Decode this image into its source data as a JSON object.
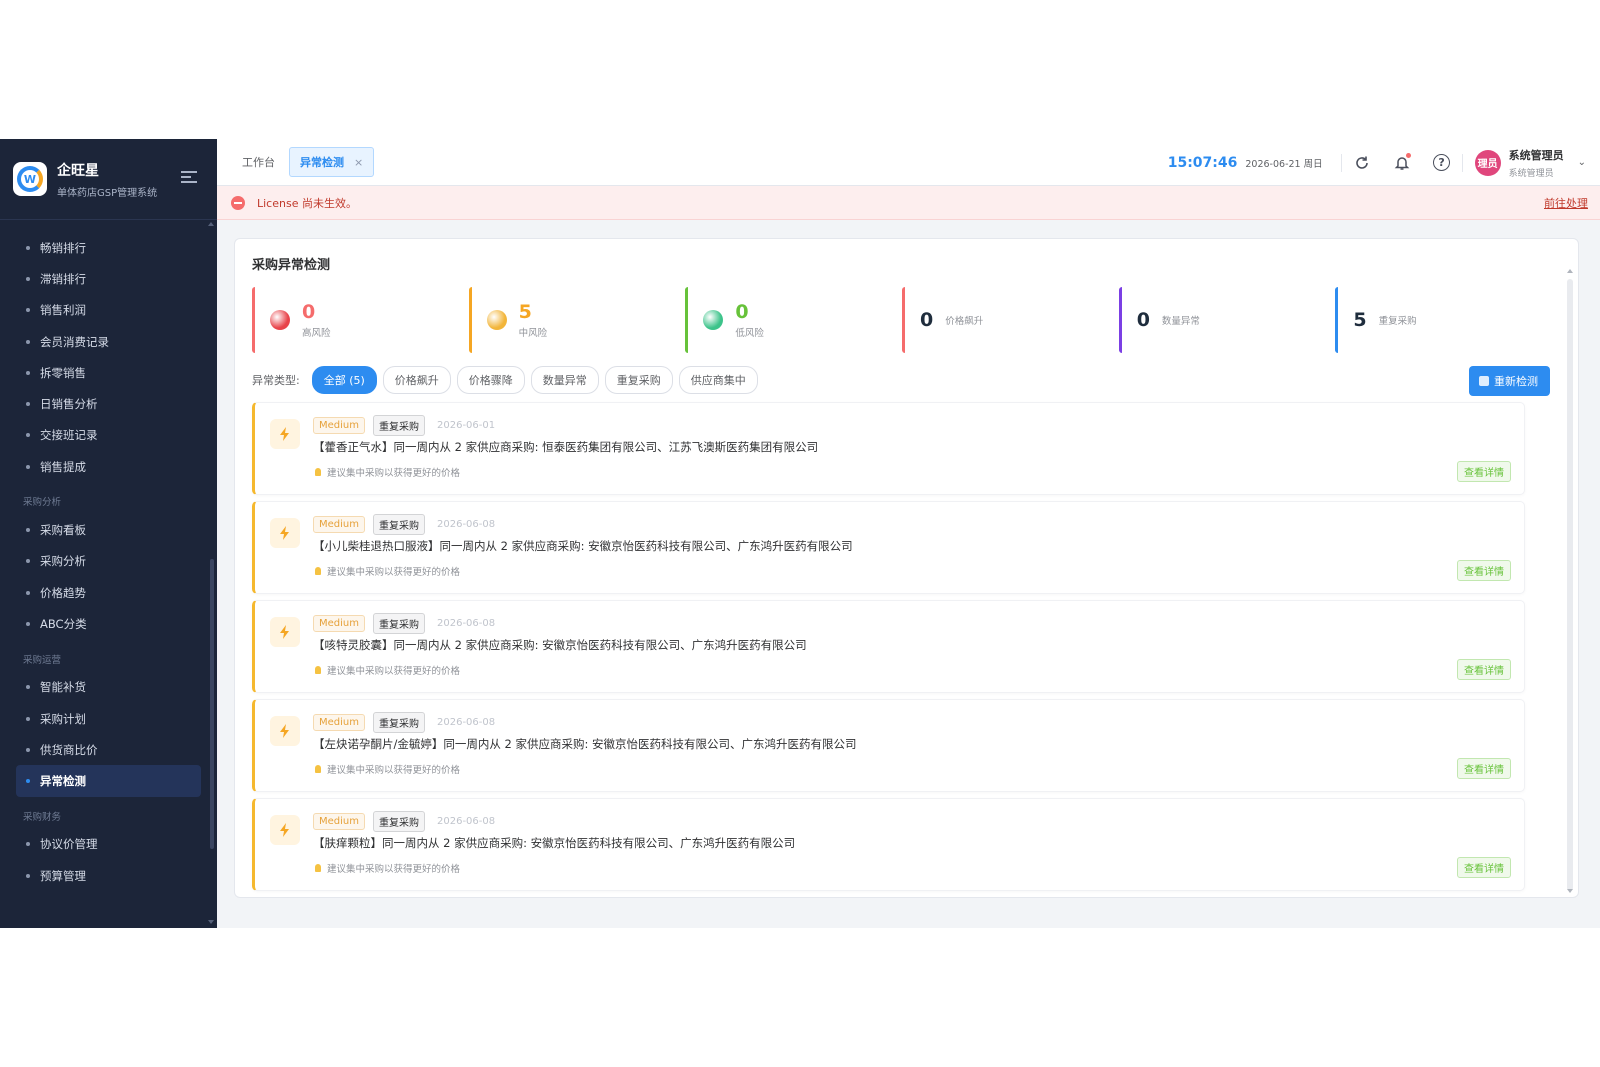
{
  "brand": {
    "name": "企旺星",
    "subtitle": "单体药店GSP管理系统",
    "logo_letter": "W"
  },
  "sidebar": {
    "sections": [
      {
        "title": "",
        "items": [
          "畅销排行",
          "滞销排行",
          "销售利润",
          "会员消费记录",
          "拆零销售",
          "日销售分析",
          "交接班记录",
          "销售提成"
        ]
      },
      {
        "title": "采购分析",
        "items": [
          "采购看板",
          "采购分析",
          "价格趋势",
          "ABC分类"
        ]
      },
      {
        "title": "采购运营",
        "items": [
          "智能补货",
          "采购计划",
          "供货商比价",
          "异常检测"
        ]
      },
      {
        "title": "采购财务",
        "items": [
          "协议价管理",
          "预算管理"
        ]
      }
    ],
    "active": "异常检测"
  },
  "topbar": {
    "tabs": [
      {
        "label": "工作台",
        "active": false
      },
      {
        "label": "异常检测",
        "active": true,
        "close": "×"
      }
    ],
    "clock": "15:07:46",
    "date": "2026-06-21 周日",
    "icons": [
      "refresh-icon",
      "bell-icon",
      "help-icon"
    ],
    "user": {
      "avatar_text": "理员",
      "name": "系统管理员",
      "role": "系统管理员"
    }
  },
  "license": {
    "message": "License 尚未生效。",
    "action": "前往处理"
  },
  "card": {
    "title": "采购异常检测",
    "stats": [
      {
        "value": "0",
        "label": "高风险",
        "color": "#f56c6c",
        "ball": "#e8434a"
      },
      {
        "value": "5",
        "label": "中风险",
        "color": "#f5a623",
        "ball": "#f2b53a"
      },
      {
        "value": "0",
        "label": "低风险",
        "color": "#67c23a",
        "ball": "#3cc38a"
      },
      {
        "value": "0",
        "label": "价格飙升",
        "color": "#f56c6c"
      },
      {
        "value": "0",
        "label": "数量异常",
        "color": "#7b3fe4"
      },
      {
        "value": "5",
        "label": "重复采购",
        "color": "#2d8cf0"
      }
    ],
    "filter_label": "异常类型:",
    "filters": [
      {
        "label": "全部 (5)",
        "active": true
      },
      {
        "label": "价格飙升"
      },
      {
        "label": "价格骤降"
      },
      {
        "label": "数量异常"
      },
      {
        "label": "重复采购"
      },
      {
        "label": "供应商集中"
      }
    ],
    "recheck_label": "重新检测",
    "items": [
      {
        "level": "Medium",
        "type": "重复采购",
        "date": "2026-06-01",
        "title": "【藿香正气水】同一周内从 2 家供应商采购: 恒泰医药集团有限公司、江苏飞澳斯医药集团有限公司",
        "hint": "建议集中采购以获得更好的价格",
        "action": "查看详情"
      },
      {
        "level": "Medium",
        "type": "重复采购",
        "date": "2026-06-08",
        "title": "【小儿柴桂退热口服液】同一周内从 2 家供应商采购: 安徽京怡医药科技有限公司、广东鸿升医药有限公司",
        "hint": "建议集中采购以获得更好的价格",
        "action": "查看详情"
      },
      {
        "level": "Medium",
        "type": "重复采购",
        "date": "2026-06-08",
        "title": "【咳特灵胶囊】同一周内从 2 家供应商采购: 安徽京怡医药科技有限公司、广东鸿升医药有限公司",
        "hint": "建议集中采购以获得更好的价格",
        "action": "查看详情"
      },
      {
        "level": "Medium",
        "type": "重复采购",
        "date": "2026-06-08",
        "title": "【左炔诺孕酮片/金毓婷】同一周内从 2 家供应商采购: 安徽京怡医药科技有限公司、广东鸿升医药有限公司",
        "hint": "建议集中采购以获得更好的价格",
        "action": "查看详情"
      },
      {
        "level": "Medium",
        "type": "重复采购",
        "date": "2026-06-08",
        "title": "【肤痒颗粒】同一周内从 2 家供应商采购: 安徽京怡医药科技有限公司、广东鸿升医药有限公司",
        "hint": "建议集中采购以获得更好的价格",
        "action": "查看详情"
      }
    ]
  }
}
